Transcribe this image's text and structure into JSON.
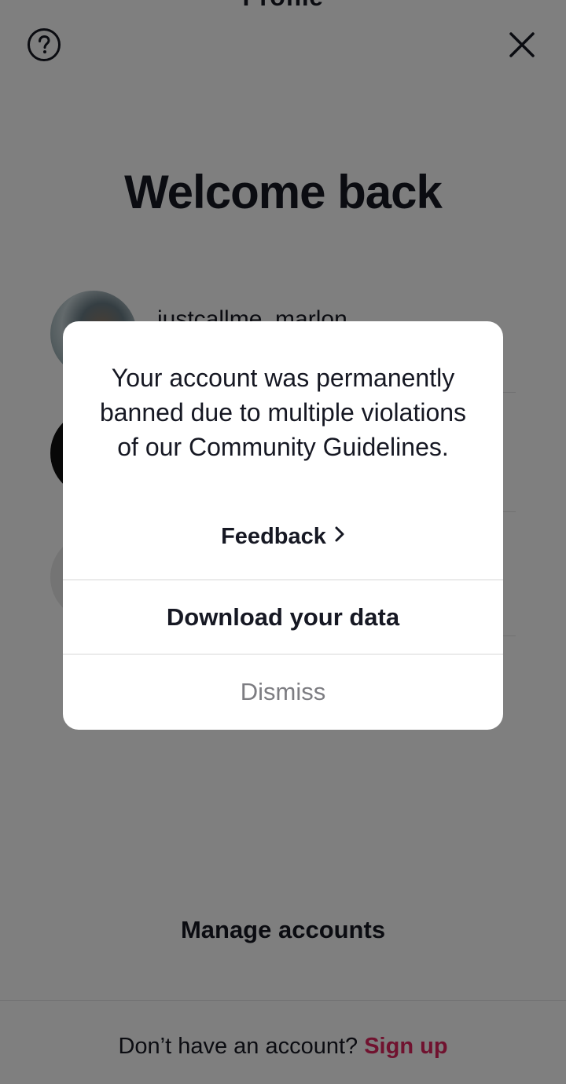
{
  "header": {
    "title": "Profile",
    "help_icon": "help-circle-icon",
    "close_icon": "close-icon"
  },
  "welcome": {
    "title": "Welcome back"
  },
  "accounts": [
    {
      "name": "justcallme_marlon"
    }
  ],
  "manage_accounts_label": "Manage accounts",
  "footer": {
    "prompt": "Don’t have an account? ",
    "signup_label": "Sign up",
    "accent_color": "#e0245e"
  },
  "modal": {
    "message": "Your account was permanently banned due to multiple violations of our Community Guidelines.",
    "feedback_label": "Feedback",
    "download_label": "Download your data",
    "dismiss_label": "Dismiss"
  }
}
